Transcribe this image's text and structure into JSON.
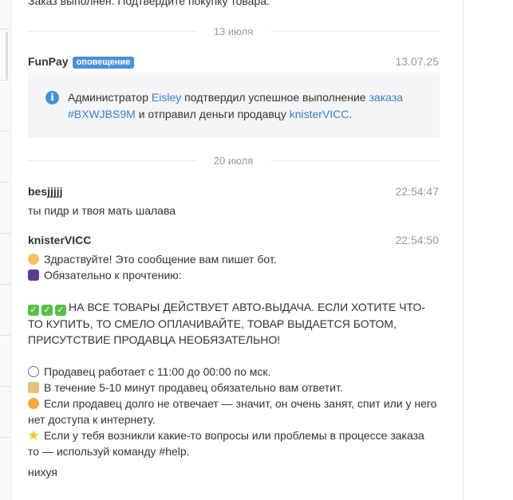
{
  "previous_message": "Заказ выполнен. Подтвердите покупку товара.",
  "dividers": [
    "13 июля",
    "20 июля"
  ],
  "notification": {
    "author": "FunPay",
    "badge": "оповещение",
    "time": "13.07.25",
    "text_1": "Администратор ",
    "admin": "Eisley",
    "text_2": " подтвердил успешное выполнение ",
    "order_link": "заказа",
    "order_id": "#BXWJBS9M",
    "text_3": " и отправил деньги продавцу ",
    "seller": "knisterVICC",
    "text_4": "."
  },
  "messages": [
    {
      "author": "besjjjjj",
      "time": "22:54:47",
      "text": "ты пидр и твоя мать шалава"
    },
    {
      "author": "knisterVICC",
      "time": "22:54:50",
      "lines": {
        "greeting": "Здраствуйте! Это сообщение вам пишет бот.",
        "must_read": "Обязательно к прочтению:",
        "auto_1": "НА ВСЕ ТОВАРЫ ДЕЙСТВУЕТ АВТО-ВЫДАЧА. ЕСЛИ ХОТИТЕ ЧТО-",
        "auto_2": "ТО КУПИТЬ, ТО СМЕЛО ОПЛАЧИВАЙТЕ, ТОВАР ВЫДАЕТСЯ БОТОМ,",
        "auto_3": "ПРИСУТСТВИЕ ПРОДАВЦА НЕОБЯЗАТЕЛЬНО!",
        "hours": "Продавец работает с 11:00 до 00:00 по мск.",
        "reply": "В течение 5-10 минут продавец обязательно вам ответит.",
        "busy_1": "Если продавец долго не отвечает — значит, он очень занят, спит или у него",
        "busy_2": "нет доступа к интернету.",
        "help_1": "Если у тебя возникли какие-то вопросы или проблемы в процессе заказа",
        "help_2": "то — используй команду #help."
      }
    },
    {
      "text": "нихуя"
    }
  ],
  "colors": {
    "link": "#3b7fc4",
    "badge": "#4a90d9",
    "notice_bg": "#f4f5f7",
    "muted": "#999999"
  },
  "icons": [
    "info-icon",
    "wave-emoji",
    "book-emoji",
    "check-emoji",
    "clock-emoji",
    "hourglass-emoji",
    "sweat-emoji",
    "star-emoji"
  ]
}
